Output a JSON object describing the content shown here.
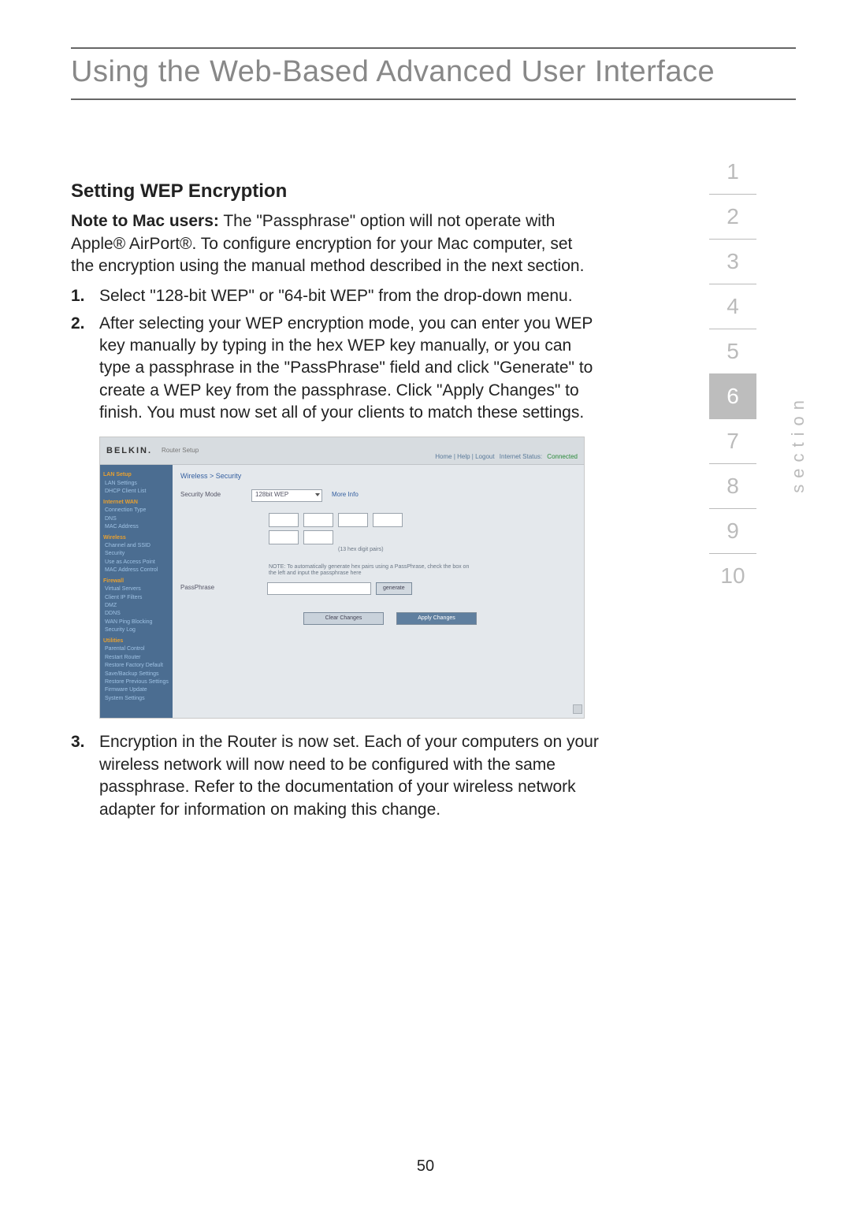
{
  "title": "Using the Web-Based Advanced User Interface",
  "heading": "Setting WEP Encryption",
  "note": {
    "label": "Note to Mac users:",
    "text": " The \"Passphrase\" option will not operate with Apple® AirPort®. To configure encryption for your Mac computer, set the encryption using the manual method described in the next section."
  },
  "steps": {
    "s1_num": "1.",
    "s1_text": "Select \"128-bit WEP\" or \"64-bit WEP\" from the drop-down menu.",
    "s2_num": "2.",
    "s2_text": "After selecting your WEP encryption mode, you can enter you WEP key manually by typing in the hex WEP key manually, or you can type a passphrase in the \"PassPhrase\" field and click \"Generate\" to create a WEP key from the passphrase. Click \"Apply Changes\" to finish. You must now set all of your clients to match these settings.",
    "s3_num": "3.",
    "s3_text": "Encryption in the Router is now set. Each of your computers on your wireless network will now need to be configured with the same passphrase. Refer to the documentation of your wireless network adapter for information on making this change."
  },
  "embedded": {
    "brand": "BELKIN.",
    "brand_sub": "Router Setup",
    "right_links": {
      "a": "Home | Help | Logout",
      "b": "Internet Status:",
      "c": "Connected"
    },
    "sidebar": {
      "g1": "LAN Setup",
      "g1a": "LAN Settings",
      "g1b": "DHCP Client List",
      "g2": "Internet WAN",
      "g2a": "Connection Type",
      "g2b": "DNS",
      "g2c": "MAC Address",
      "g3": "Wireless",
      "g3a": "Channel and SSID",
      "g3b": "Security",
      "g3c": "Use as Access Point",
      "g3d": "MAC Address Control",
      "g4": "Firewall",
      "g4a": "Virtual Servers",
      "g4b": "Client IP Filters",
      "g4c": "DMZ",
      "g4d": "DDNS",
      "g4e": "WAN Ping Blocking",
      "g4f": "Security Log",
      "g5": "Utilities",
      "g5a": "Parental Control",
      "g5b": "Restart Router",
      "g5c": "Restore Factory Default",
      "g5d": "Save/Backup Settings",
      "g5e": "Restore Previous Settings",
      "g5f": "Firmware Update",
      "g5g": "System Settings"
    },
    "breadcrumb": "Wireless > Security",
    "security_mode_label": "Security Mode",
    "security_mode_value": "128bit WEP",
    "more_info": "More Info",
    "hex_hint": "(13 hex digit pairs)",
    "note_text": "NOTE:  To automatically generate hex pairs using a PassPhrase, check the box on the left and input the passphrase here",
    "passphrase_label": "PassPhrase",
    "generate": "generate",
    "clear": "Clear Changes",
    "apply": "Apply Changes"
  },
  "section_label": "section",
  "sections": [
    "1",
    "2",
    "3",
    "4",
    "5",
    "6",
    "7",
    "8",
    "9",
    "10"
  ],
  "active_section_index": 5,
  "page_number": "50"
}
